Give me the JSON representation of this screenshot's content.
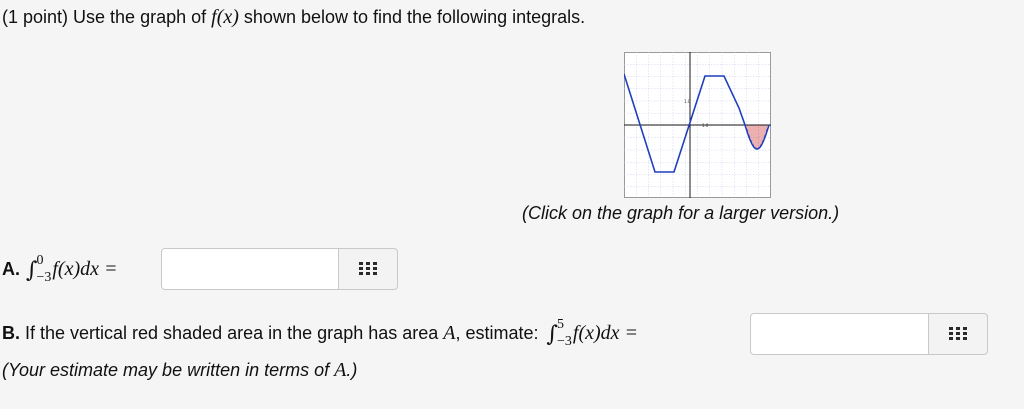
{
  "question": {
    "title_text": "(1 point) Use the graph of",
    "title_func": "f(x)",
    "title_rest": "shown below to find the following integrals."
  },
  "graph": {
    "caption": "(Click on the graph for a larger version.)",
    "tick_label_upper": "1.0",
    "tick_label_axis": "1.0",
    "line_color": "#1f3fbf",
    "shade_color": "#d23a3a",
    "grid_color": "#c8d0e8"
  },
  "part_a": {
    "label": "A.",
    "upper_limit": "0",
    "lower_limit": "−3",
    "integrand": "f(x)dx =",
    "answer_value": ""
  },
  "part_b": {
    "label": "B.",
    "text": "If the vertical red shaded area in the graph has area",
    "area_symbol": "A",
    "text_after": ", estimate:",
    "upper_limit": "5",
    "lower_limit": "−3",
    "integrand": "f(x)dx =",
    "answer_value": ""
  },
  "note": {
    "text": "(Your estimate may be written in terms of",
    "symbol": "A",
    "close": ".)"
  }
}
